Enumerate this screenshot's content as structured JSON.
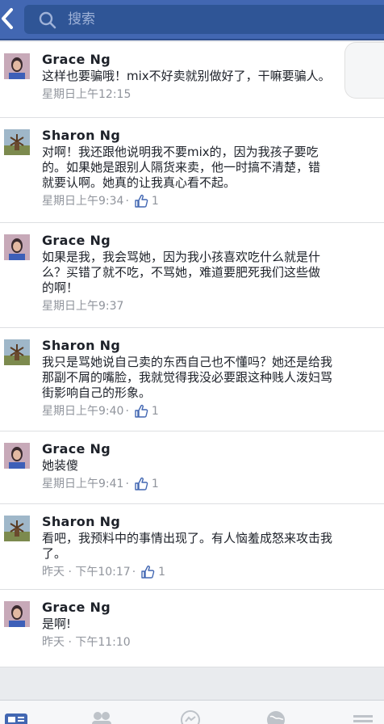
{
  "search": {
    "placeholder": "搜索"
  },
  "comments": [
    {
      "author": "Grace  Ng",
      "lines": [
        "这样也要骗哦！mix不好卖就别做好了，干嘛要骗人。"
      ],
      "time": "星期日上午12:15",
      "likes": null
    },
    {
      "author": "Sharon Ng",
      "lines": [
        "对啊！我还跟他说明我不要mix的，因为我孩子要吃",
        "的。如果她是跟别人隔货来卖，他一时搞不清楚，错",
        "就要认啊。她真的让我真心看不起。"
      ],
      "time": "星期日上午9:34",
      "likes": "1"
    },
    {
      "author": "Grace  Ng",
      "lines": [
        "如果是我，我会骂她，因为我小孩喜欢吃什么就是什",
        "么？买错了就不吃，不骂她，难道要肥死我们这些做",
        "的啊！"
      ],
      "time": "星期日上午9:37",
      "likes": null
    },
    {
      "author": "Sharon Ng",
      "lines": [
        "我只是骂她说自己卖的东西自己也不懂吗？她还是给我",
        "那副不屑的嘴脸，我就觉得我没必要跟这种贱人泼妇骂",
        "街影响自己的形象。"
      ],
      "time": "星期日上午9:40",
      "likes": "1"
    },
    {
      "author": "Grace  Ng",
      "lines": [
        "她装傻"
      ],
      "time": "星期日上午9:41",
      "likes": "1"
    },
    {
      "author": "Sharon Ng",
      "lines": [
        "看吧，我预料中的事情出现了。有人恼羞成怒来攻击我",
        "了。"
      ],
      "time": "昨天 · 下午10:17",
      "likes": "1"
    },
    {
      "author": "Grace  Ng",
      "lines": [
        "是啊!"
      ],
      "time": "昨天 · 下午11:10",
      "likes": null
    }
  ],
  "colors": {
    "brand": "#4267b2",
    "meta": "#90949c"
  },
  "icons": [
    "back-chevron-icon",
    "search-icon",
    "like-thumb-icon",
    "news-feed-icon",
    "friends-icon",
    "messenger-icon",
    "globe-icon",
    "menu-icon"
  ]
}
